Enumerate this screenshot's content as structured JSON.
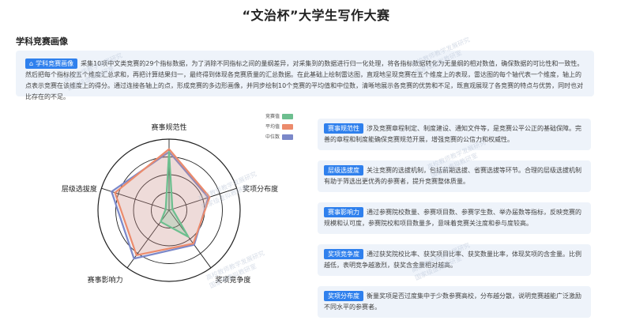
{
  "page_title": "“文治杯”大学生写作大赛",
  "section_title": "学科竞赛画像",
  "intro": {
    "tag": "学科竞赛画像",
    "text": "采集10项中文类竞赛的29个指标数据，为了消除不同指标之间的量纲差异，对采集到的数据进行归一化处理，将各指标数据转化为无量纲的相对数值，确保数据的可比性和一致性。然后把每个指标按五个维度汇总求和，再把计算结果归一，最终得到体现各竞赛质量的汇总数据。在此基础上绘制雷达图，直观地呈现竞赛在五个维度上的表现，雷达图的每个轴代表一个维度，轴上的点表示竞赛在该维度上的得分。通过连接各轴上的点，形成竞赛的多边形画像，并同步绘制10个竞赛的平均值和中位数，清晰地展示各竞赛的优势和不足，既直观展现了各竞赛的特点与优势，同时也对比存在的不足。"
  },
  "chart_data": {
    "type": "radar",
    "axes": [
      "赛事规范性",
      "奖项分布度",
      "奖项竞争度",
      "赛事影响力",
      "层级选拔度"
    ],
    "series": [
      {
        "name": "竞赛值",
        "color": "#6dbf8f",
        "values": [
          0.82,
          0.05,
          0.46,
          0.2,
          0.05
        ]
      },
      {
        "name": "平均值",
        "color": "#ec8b6c",
        "values": [
          0.86,
          0.6,
          0.58,
          0.78,
          0.8
        ]
      },
      {
        "name": "中位数",
        "color": "#7b88c9",
        "values": [
          0.82,
          0.58,
          0.6,
          0.84,
          0.85
        ]
      }
    ],
    "rings": 4,
    "legend_position": "top-right"
  },
  "cards": [
    {
      "tag": "赛事规范性",
      "text": "涉及竞赛章程制定、制度建设、通知文件等，是竞赛公平公正的基础保障。完善的章程和制度能确保竞赛规范开展，增强竞赛的公信力和权威性。"
    },
    {
      "tag": "层级选拔度",
      "text": "关注竞赛的选拔机制，包括前期选拔、省赛选拔等环节。合理的层级选拔机制有助于筛选出更优秀的参赛者，提升竞赛整体质量。"
    },
    {
      "tag": "赛事影响力",
      "text": "通过参赛院校数量、参赛项目数、参赛学生数、举办届数等指标，反映竞赛的规模和认可度，参赛院校和项目数量多，意味着竞赛关注度和参与度较高。"
    },
    {
      "tag": "奖项竞争度",
      "text": "通过获奖院校比率、获奖项目比率、获奖数量比率，体现奖项的含金量。比例越低，表明竞争越激烈，获奖含金量相对越高。"
    },
    {
      "tag": "奖项分布度",
      "text": "衡量奖项是否过度集中于少数参赛高校，分布越分散，说明竞赛越能广泛激励不同水平的参赛者。"
    }
  ],
  "watermark": {
    "line1": "高校教师教学发展研究",
    "line2": "国家级虚拟教研室"
  }
}
